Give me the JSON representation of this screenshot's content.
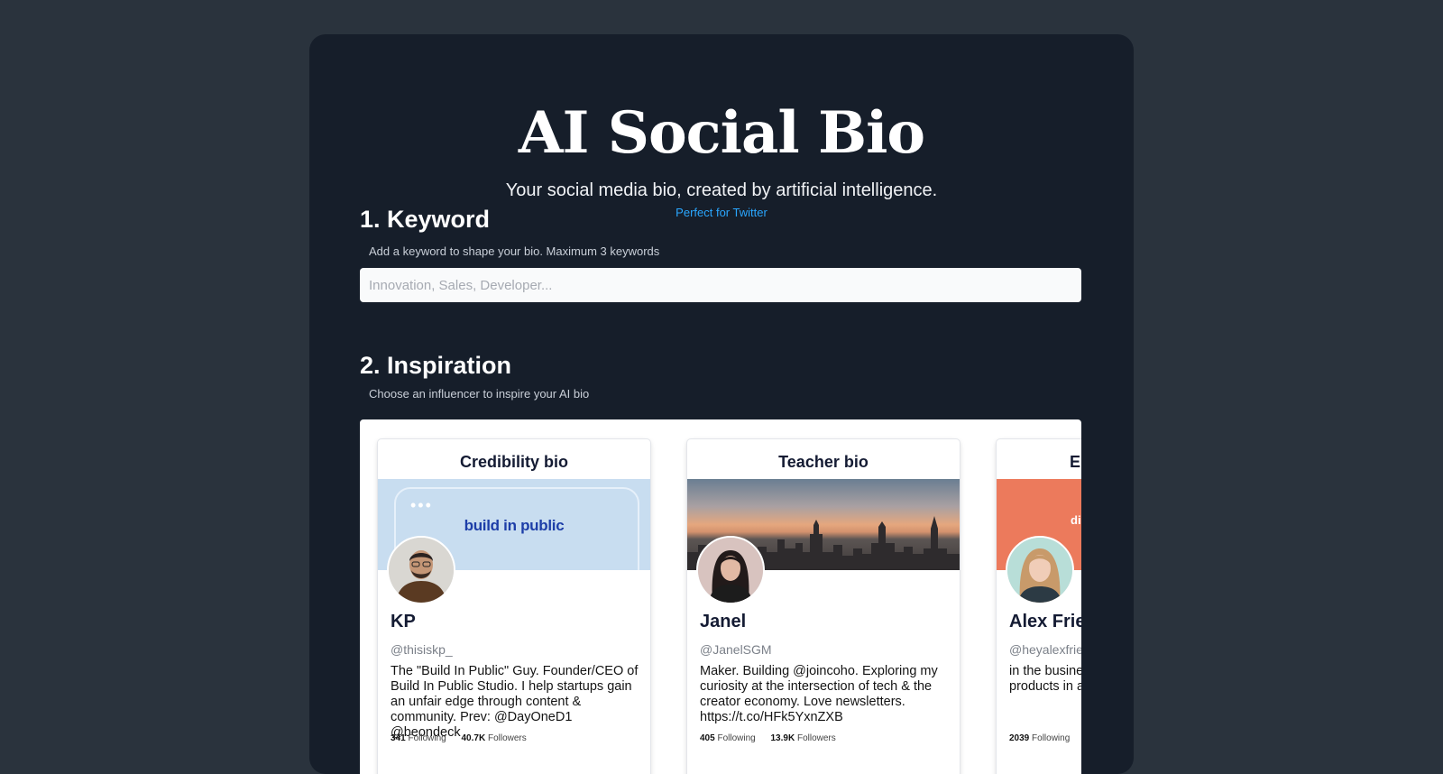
{
  "header": {
    "title": "AI Social Bio",
    "subtitle": "Your social media bio, created by artificial intelligence.",
    "link": "Perfect for Twitter"
  },
  "keyword": {
    "title": "1. Keyword",
    "hint": "Add a keyword to shape your bio. Maximum 3 keywords",
    "placeholder": "Innovation, Sales, Developer...",
    "value": ""
  },
  "inspiration": {
    "title": "2. Inspiration",
    "hint": "Choose an influencer to inspire your AI bio",
    "cards": [
      {
        "heading": "Credibility bio",
        "banner_text": "build in public",
        "name": "KP",
        "handle": "@thisiskp_",
        "bio": "The \"Build In Public\" Guy. Founder/CEO of Build In Public Studio. I help startups gain an unfair edge through content & community. Prev: @DayOneD1 @beondeck",
        "following_count": "341",
        "following_label": "Following",
        "followers_count": "40.7K",
        "followers_label": "Followers"
      },
      {
        "heading": "Teacher bio",
        "name": "Janel",
        "handle": "@JanelSGM",
        "bio": "Maker. Building @joincoho. Exploring my curiosity at the intersection of tech & the creator economy. Love newsletters. https://t.co/HFk5YxnZXB",
        "following_count": "405",
        "following_label": "Following",
        "followers_count": "13.9K",
        "followers_label": "Followers"
      },
      {
        "heading": "E",
        "banner_text": "discov",
        "name": "Alex Frie",
        "handle": "@heyalexfried",
        "bio": "in the busine belonging • @Techstars products in a",
        "following_count": "2039",
        "following_label": "Following"
      }
    ]
  },
  "colors": {
    "page_background": "#2a333d",
    "panel_background": "#161e2a",
    "link": "#2aa7ff",
    "banner_blue": "#c8ddf0",
    "banner_orange": "#ec7a5c"
  }
}
